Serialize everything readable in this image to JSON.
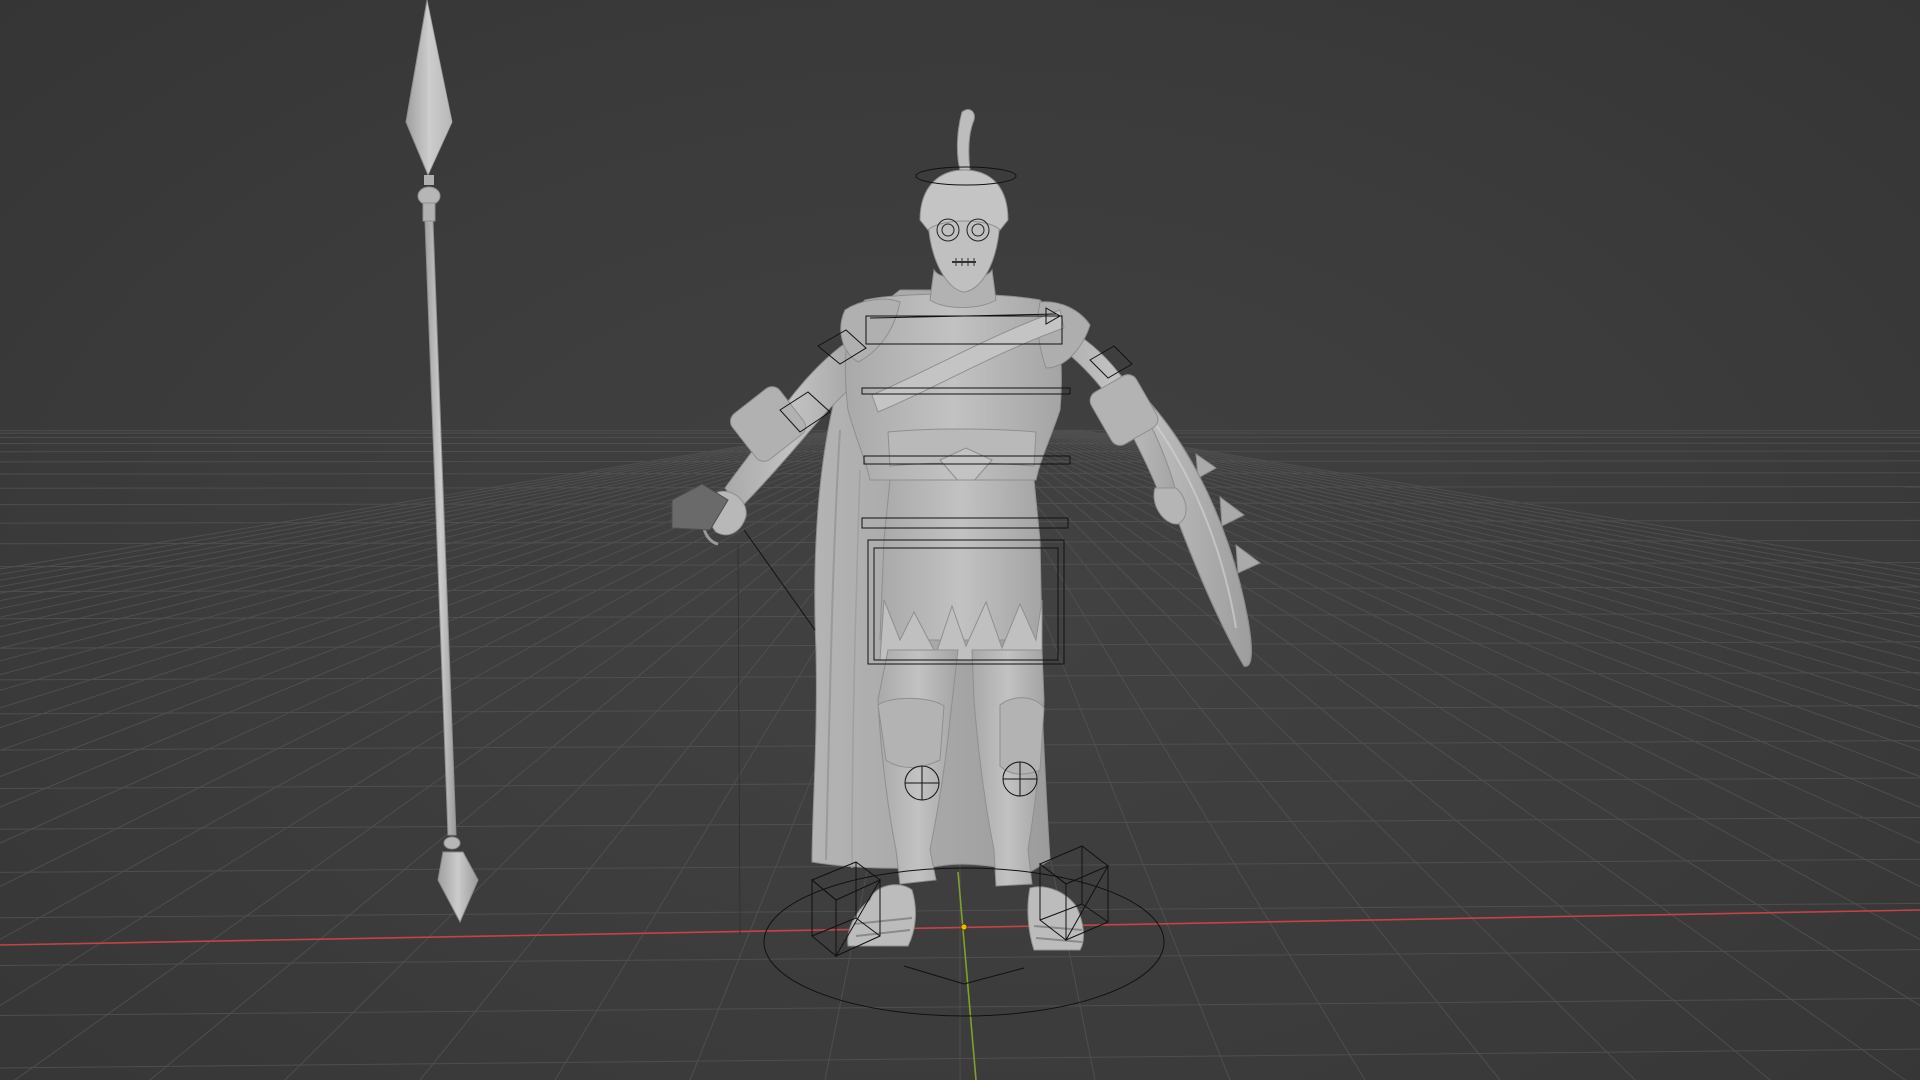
{
  "viewport": {
    "mode": "object-viewport",
    "background_color": "#3d3d3d",
    "grid_color": "#555555",
    "x_axis_color": "#c4424a",
    "y_axis_color": "#7ea12a",
    "origin_color": "#f2b705"
  },
  "scene": {
    "objects": [
      {
        "name": "warrior-character",
        "material_color": "#b9b9b9",
        "shade_color": "#a3a3a3"
      },
      {
        "name": "spear",
        "material_color": "#bdbdbd"
      },
      {
        "name": "shield",
        "material_color": "#b5b5b5"
      },
      {
        "name": "armature-rig",
        "wire_color": "#111111"
      },
      {
        "name": "hand-grip-object",
        "material_color": "#6a6a6a"
      }
    ]
  }
}
